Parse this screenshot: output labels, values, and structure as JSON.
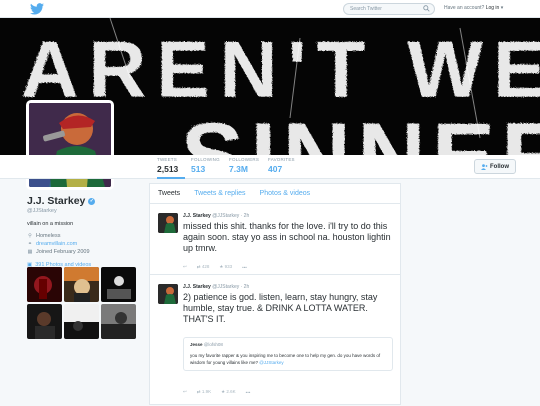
{
  "header": {
    "search_placeholder": "Search Twitter",
    "account_prompt": "Have an account?",
    "login_label": "Log in"
  },
  "banner": {
    "line1": "AREN'T WE",
    "line2": "SINNERS?"
  },
  "stats": [
    {
      "label": "TWEETS",
      "value": "2,513"
    },
    {
      "label": "FOLLOWING",
      "value": "513"
    },
    {
      "label": "FOLLOWERS",
      "value": "7.3M"
    },
    {
      "label": "FAVORITES",
      "value": "407"
    }
  ],
  "follow_label": "Follow",
  "profile": {
    "name": "J.J. Starkey",
    "handle": "@JJStarkey",
    "bio": "villain on a mission",
    "location": "Homeless",
    "website": "dreamvillain.com",
    "joined": "Joined February 2009",
    "photos_link": "391 Photos and videos"
  },
  "tabs": [
    "Tweets",
    "Tweets & replies",
    "Photos & videos"
  ],
  "tweets": [
    {
      "name": "J.J. Starkey",
      "handle": "@JJStarkey",
      "time": "· 2h",
      "text": "missed this shit. thanks for the love. i'll try to do this again soon. stay yo ass in school na. houston lightin up tmrw.",
      "retweets": "428",
      "favorites": "933"
    },
    {
      "name": "J.J. Starkey",
      "handle": "@JJStarkey",
      "time": "· 2h",
      "text": "2) patience is god. listen, learn, stay hungry, stay humble, stay true. & DRINK A LOTTA WATER. THAT'S IT.",
      "quote": {
        "name": "Jesse",
        "handle": "@lofsh08",
        "text": "you my favorite rapper & you inspiring me to become one to help my gen. do you have words of wisdom for young villains like me?",
        "mention": "@JJStarkey"
      },
      "retweets": "1.9K",
      "favorites": "2.6K"
    }
  ],
  "colors": {
    "accent": "#55acee",
    "text": "#292f33",
    "muted": "#8899a6",
    "border": "#e1e8ed"
  },
  "icons": [
    "twitter-bird-icon",
    "search-icon",
    "verified-badge-icon",
    "location-pin-icon",
    "link-icon",
    "calendar-icon",
    "photo-icon",
    "reply-icon",
    "retweet-icon",
    "favorite-icon",
    "more-icon",
    "follow-person-icon"
  ]
}
